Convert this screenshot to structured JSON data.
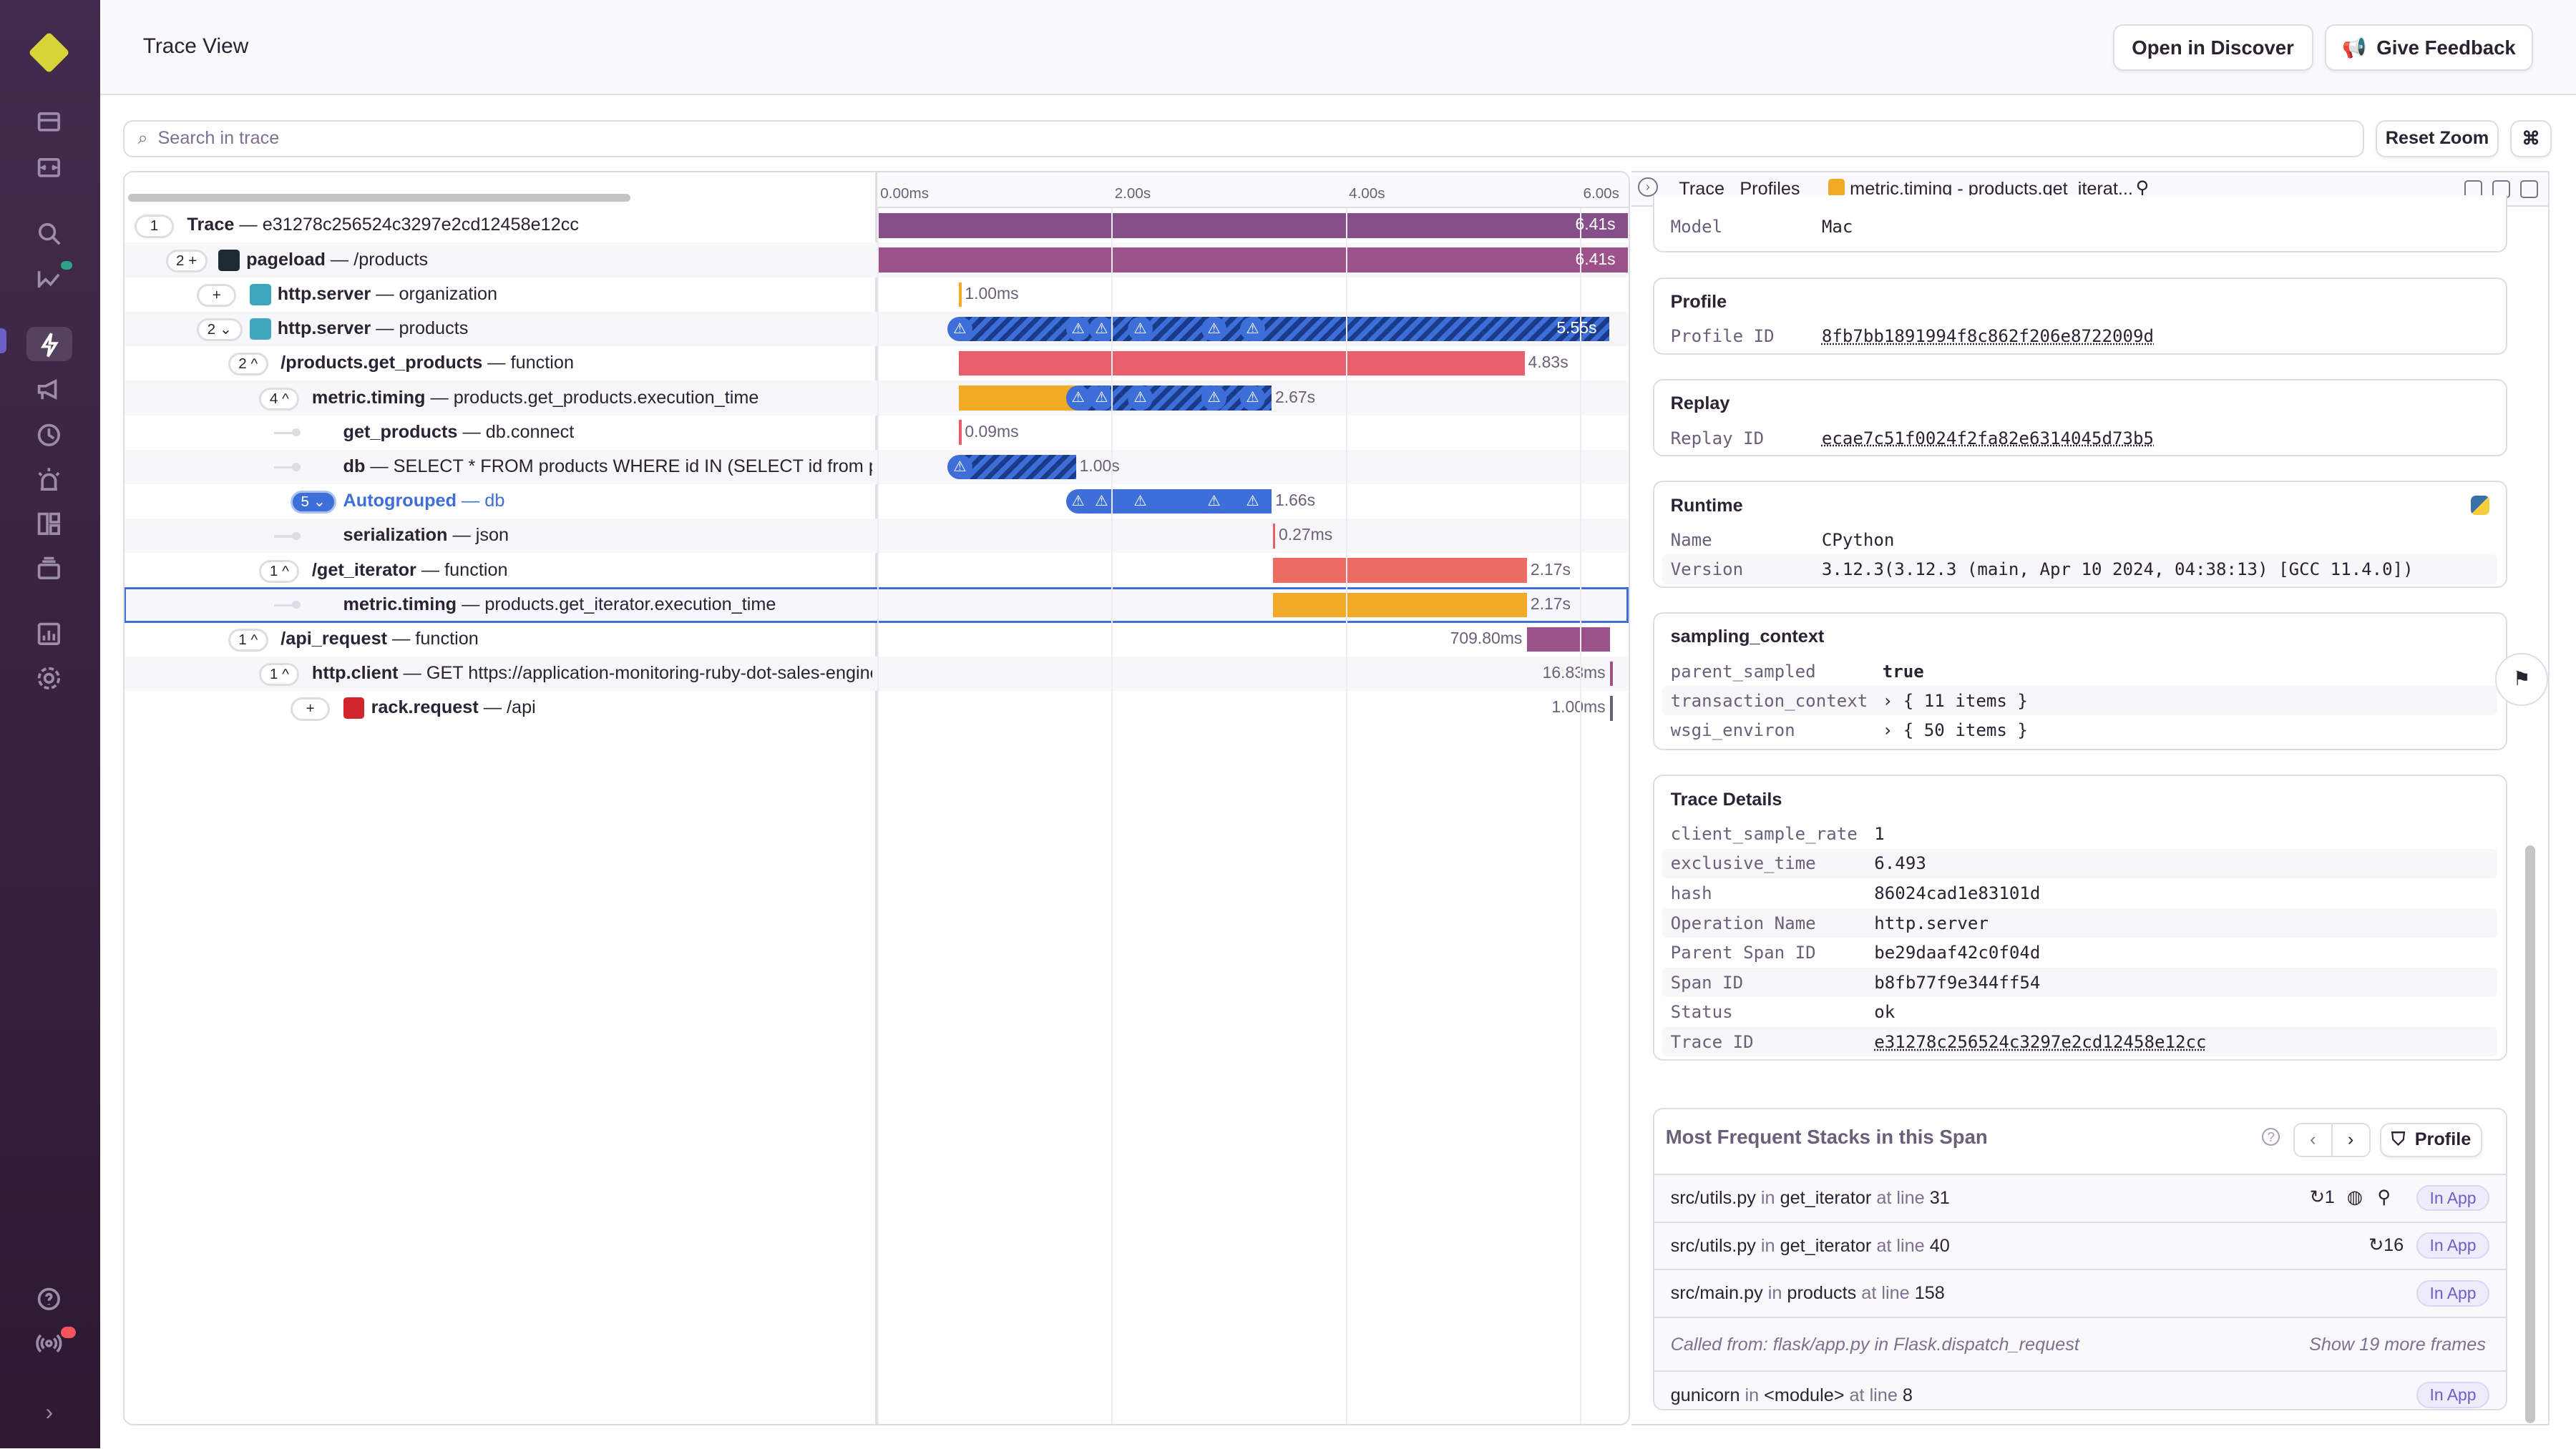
{
  "header": {
    "title": "Trace View",
    "open_discover": "Open in Discover",
    "give_feedback": "Give Feedback"
  },
  "search": {
    "placeholder": "Search in trace",
    "reset_zoom": "Reset Zoom",
    "shortcut": "⌘"
  },
  "sidebar": {
    "items": [
      "issues",
      "projects",
      "explore",
      "insights",
      "performance",
      "feedback",
      "crons",
      "alerts",
      "dashboards",
      "releases",
      "stats",
      "settings",
      "help",
      "broadcasts",
      "collapse"
    ],
    "active": "performance"
  },
  "timeline": {
    "ticks": [
      {
        "label": "0.00ms",
        "value": 0
      },
      {
        "label": "2.00s",
        "value": 2
      },
      {
        "label": "4.00s",
        "value": 4
      },
      {
        "label": "6.00s",
        "value": 6
      }
    ]
  },
  "colors": {
    "purple": "#85508a",
    "pink": "#9a5289",
    "red": "#e85e6d",
    "salmon": "#ec6c63",
    "orange": "#f2a926",
    "blue": "#3e6ed8",
    "dark_blue": "#1a3a8a"
  },
  "rows": [
    {
      "level": 0,
      "count": "1",
      "op": "Trace",
      "desc": "e31278c256524c3297e2cd12458e12cc",
      "start": 0,
      "dur": 6.41,
      "dur_label": "6.41s",
      "color": "#85508a",
      "label_inside": true
    },
    {
      "level": 1,
      "count": "2 +",
      "icon": "react",
      "op": "pageload",
      "desc": "/products",
      "start": 0,
      "dur": 6.41,
      "dur_label": "6.41s",
      "color": "#9a5289",
      "label_inside": true
    },
    {
      "level": 2,
      "count": "+",
      "icon": "flask",
      "op": "http.server",
      "desc": "organization",
      "start": 0.7,
      "dur": 0.001,
      "dur_label": "1.00ms",
      "color": "#f2a926"
    },
    {
      "level": 2,
      "count": "2 ⌄",
      "icon": "flask",
      "op": "http.server",
      "desc": "products",
      "start": 0.7,
      "dur": 5.55,
      "dur_label": "5.55s",
      "hatch": true,
      "label_inside": true,
      "warnings": [
        0.7,
        1.71,
        1.91,
        2.24,
        2.87,
        3.2
      ]
    },
    {
      "level": 3,
      "count": "2 ^",
      "op": "/products.get_products",
      "desc": "function",
      "start": 0.7,
      "dur": 4.83,
      "dur_label": "4.83s",
      "color": "#e85e6d"
    },
    {
      "level": 4,
      "count": "4 ^",
      "op": "metric.timing",
      "desc": "products.get_products.execution_time",
      "start": 0.7,
      "dur": 2.67,
      "dur_label": "2.67s",
      "color": "#f2a926",
      "hatch_from": 1.71,
      "warnings": [
        1.71,
        1.91,
        2.24,
        2.87,
        3.2
      ]
    },
    {
      "level": 5,
      "leaf": true,
      "op": "get_products",
      "desc": "db.connect",
      "start": 0.7,
      "dur": 0.0001,
      "dur_label": "0.09ms",
      "color": "#e85e6d"
    },
    {
      "level": 5,
      "leaf": true,
      "op": "db",
      "desc": "SELECT * FROM products WHERE id IN (SELECT id from products)",
      "start": 0.7,
      "dur": 1.0,
      "dur_label": "1.00s",
      "hatch": true,
      "warnings": [
        0.7
      ]
    },
    {
      "level": 5,
      "count": "5 ⌄",
      "blue": true,
      "op": "Autogrouped",
      "desc": "db",
      "start": 1.71,
      "dur": 1.66,
      "dur_label": "1.66s",
      "color": "#3e6ed8",
      "warnings": [
        1.71,
        1.91,
        2.24,
        2.87,
        3.2
      ]
    },
    {
      "level": 5,
      "leaf": true,
      "op": "serialization",
      "desc": "json",
      "start": 3.38,
      "dur": 0.0003,
      "dur_label": "0.27ms",
      "color": "#e85e6d"
    },
    {
      "level": 4,
      "count": "1 ^",
      "op": "/get_iterator",
      "desc": "function",
      "start": 3.38,
      "dur": 2.17,
      "dur_label": "2.17s",
      "color": "#ec6c63"
    },
    {
      "level": 5,
      "leaf": true,
      "selected": true,
      "op": "metric.timing",
      "desc": "products.get_iterator.execution_time",
      "start": 3.38,
      "dur": 2.17,
      "dur_label": "2.17s",
      "color": "#f2a926"
    },
    {
      "level": 3,
      "count": "1 ^",
      "op": "/api_request",
      "desc": "function",
      "start": 5.55,
      "dur": 0.7098,
      "dur_label": "709.80ms",
      "color": "#9a5289",
      "label_left": true
    },
    {
      "level": 4,
      "count": "1 ^",
      "op": "http.client",
      "desc": "GET https://application-monitoring-ruby-dot-sales-engineering",
      "start": 6.26,
      "dur": 0.01683,
      "dur_label": "16.83ms",
      "color": "#9a5289",
      "label_left": true
    },
    {
      "level": 5,
      "count": "+",
      "icon": "ruby",
      "op": "rack.request",
      "desc": "/api",
      "start": 6.26,
      "dur": 0.001,
      "dur_label": "1.00ms",
      "color": "#6c5f7a",
      "label_left": true
    }
  ],
  "panel": {
    "tabs": [
      "Trace",
      "Profiles"
    ],
    "active_tab": "metric.timing - products.get_iterat...",
    "model": {
      "key": "Model",
      "value": "Mac"
    },
    "profile": {
      "title": "Profile",
      "key": "Profile ID",
      "value": "8fb7bb1891994f8c862f206e8722009d"
    },
    "replay": {
      "title": "Replay",
      "key": "Replay ID",
      "value": "ecae7c51f0024f2fa82e6314045d73b5"
    },
    "runtime": {
      "title": "Runtime",
      "name_key": "Name",
      "name": "CPython",
      "version_key": "Version",
      "version": "3.12.3(3.12.3 (main, Apr 10 2024, 04:38:13) [GCC 11.4.0])"
    },
    "sampling": {
      "title": "sampling_context",
      "rows": [
        {
          "k": "parent_sampled",
          "v": "true"
        },
        {
          "k": "transaction_context",
          "v": "› { 11 items }"
        },
        {
          "k": "wsgi_environ",
          "v": "› { 50 items }"
        }
      ]
    },
    "trace_details": {
      "title": "Trace Details",
      "rows": [
        {
          "k": "client_sample_rate",
          "v": "1",
          "t": "num"
        },
        {
          "k": "exclusive_time",
          "v": "6.493",
          "t": "num"
        },
        {
          "k": "hash",
          "v": "86024cad1e83101d"
        },
        {
          "k": "Operation Name",
          "v": "http.server"
        },
        {
          "k": "Parent Span ID",
          "v": "be29daaf42c0f04d"
        },
        {
          "k": "Span ID",
          "v": "b8fb77f9e344ff54"
        },
        {
          "k": "Status",
          "v": "ok"
        },
        {
          "k": "Trace ID",
          "v": "e31278c256524c3297e2cd12458e12cc",
          "t": "link"
        }
      ]
    },
    "stacks": {
      "title": "Most Frequent Stacks in this Span",
      "profile_btn": "Profile",
      "in": "in",
      "at_line": "at line",
      "in_app": "In App",
      "frames": [
        {
          "file": "src/utils.py",
          "func": "get_iterator",
          "line": "31",
          "repeat": "1",
          "extra_icons": true
        },
        {
          "file": "src/utils.py",
          "func": "get_iterator",
          "line": "40",
          "repeat": "16"
        },
        {
          "file": "src/main.py",
          "func": "products",
          "line": "158"
        }
      ],
      "called_from": "Called from: flask/app.py  in  Flask.dispatch_request",
      "show_more": "Show 19 more frames",
      "last": {
        "file": "gunicorn",
        "func": "<module>",
        "line": "8"
      }
    }
  }
}
